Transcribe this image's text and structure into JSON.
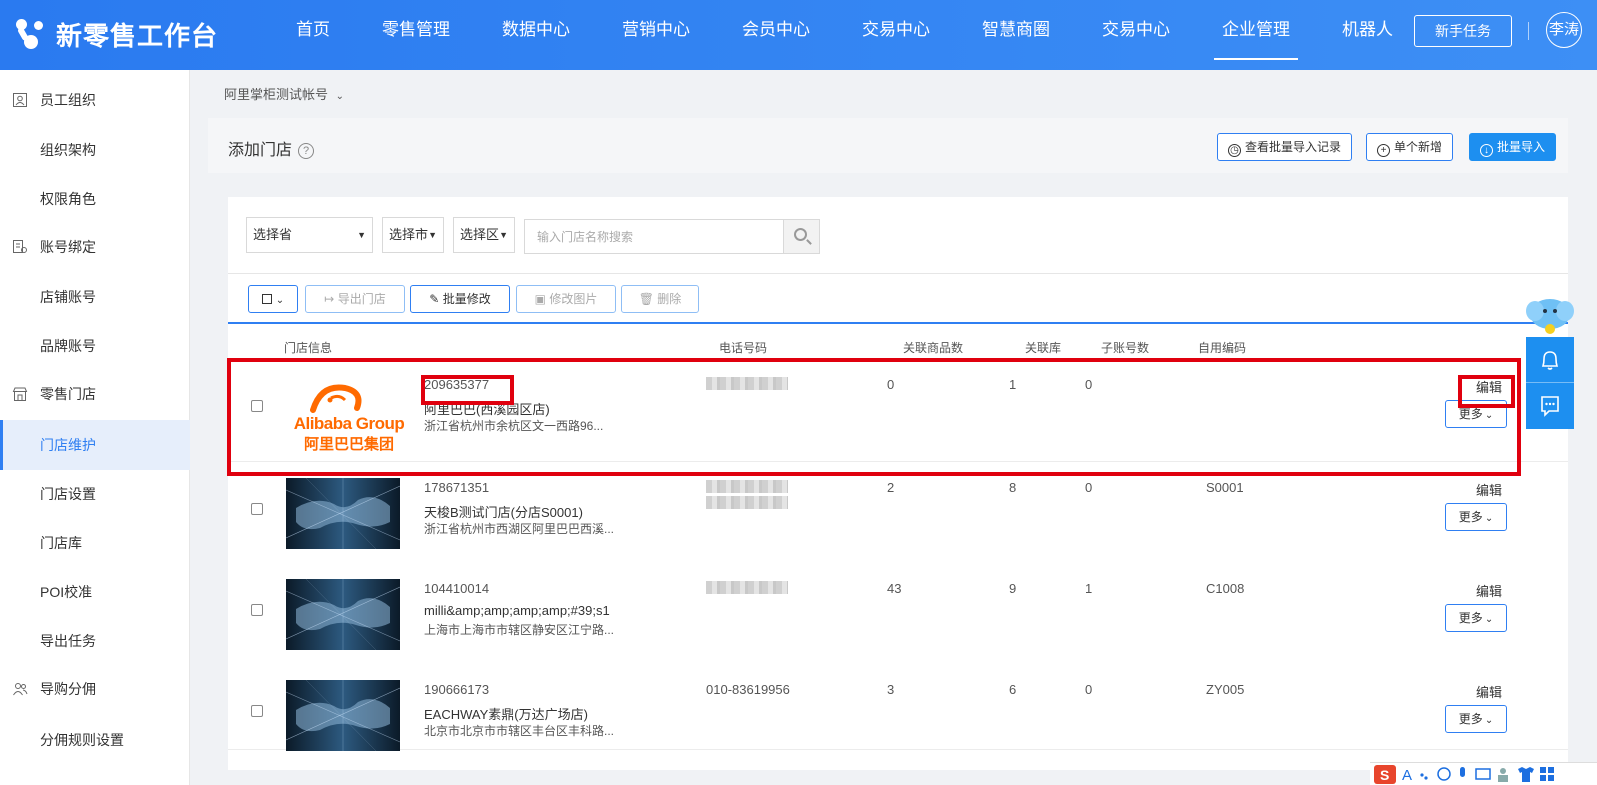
{
  "app": {
    "title": "新零售工作台"
  },
  "nav": {
    "items": [
      "首页",
      "零售管理",
      "数据中心",
      "营销中心",
      "会员中心",
      "交易中心",
      "智慧商圈",
      "交易中心",
      "企业管理",
      "机器人"
    ],
    "active_index": 8,
    "new_task": "新手任务",
    "user": "李涛"
  },
  "sidebar": {
    "groups": [
      {
        "label": "员工组织",
        "icon": "person-card-icon"
      },
      {
        "label": "账号绑定",
        "icon": "account-bind-icon"
      },
      {
        "label": "零售门店",
        "icon": "store-icon"
      },
      {
        "label": "导购分佣",
        "icon": "people-icon"
      }
    ],
    "items": [
      "组织架构",
      "权限角色",
      "店铺账号",
      "品牌账号",
      "门店维护",
      "门店设置",
      "门店库",
      "POI校准",
      "导出任务",
      "分佣规则设置"
    ],
    "active_item": "门店维护"
  },
  "breadcrumb": {
    "account": "阿里掌柜测试帐号"
  },
  "page": {
    "title": "添加门店",
    "buttons": {
      "history": "查看批量导入记录",
      "single_add": "单个新增",
      "batch_import": "批量导入"
    }
  },
  "filters": {
    "province": "选择省",
    "city": "选择市",
    "district": "选择区",
    "search_placeholder": "输入门店名称搜索"
  },
  "toolbar": {
    "export": "导出门店",
    "batch_edit": "批量修改",
    "edit_image": "修改图片",
    "delete": "删除"
  },
  "table": {
    "headers": {
      "info": "门店信息",
      "phone": "电话号码",
      "goods": "关联商品数",
      "library": "关联库",
      "sub_accounts": "子账号数",
      "code": "自用编码"
    },
    "rows": [
      {
        "id": "209635377",
        "name": "阿里巴巴(西溪园区店)",
        "address": "浙江省杭州市余杭区文一西路96...",
        "phone": "",
        "goods": "0",
        "library": "1",
        "sub": "0",
        "code": "",
        "image": "alibaba-logo",
        "edit": "编辑",
        "more": "更多"
      },
      {
        "id": "178671351",
        "name": "天梭B测试门店(分店S0001)",
        "address": "浙江省杭州市西湖区阿里巴巴西溪...",
        "phone": "",
        "goods": "2",
        "library": "8",
        "sub": "0",
        "code": "S0001",
        "image": "world-map",
        "edit": "编辑",
        "more": "更多"
      },
      {
        "id": "104410014",
        "name": "milli&amp;amp;amp;amp;#39;s1",
        "address": "上海市上海市市辖区静安区江宁路...",
        "phone": "",
        "goods": "43",
        "library": "9",
        "sub": "1",
        "code": "C1008",
        "image": "world-map",
        "edit": "编辑",
        "more": "更多"
      },
      {
        "id": "190666173",
        "name": "EACHWAY素鼎(万达广场店)",
        "address": "北京市北京市市辖区丰台区丰科路...",
        "phone": "010-83619956",
        "goods": "3",
        "library": "6",
        "sub": "0",
        "code": "ZY005",
        "image": "world-map",
        "edit": "编辑",
        "more": "更多"
      }
    ]
  },
  "logo_text": {
    "brand": "Alibaba Group",
    "cn": "阿里巴巴集团"
  },
  "colors": {
    "primary": "#2f7ff2",
    "highlight": "#e0000e",
    "logo_orange": "#ff6a00"
  }
}
